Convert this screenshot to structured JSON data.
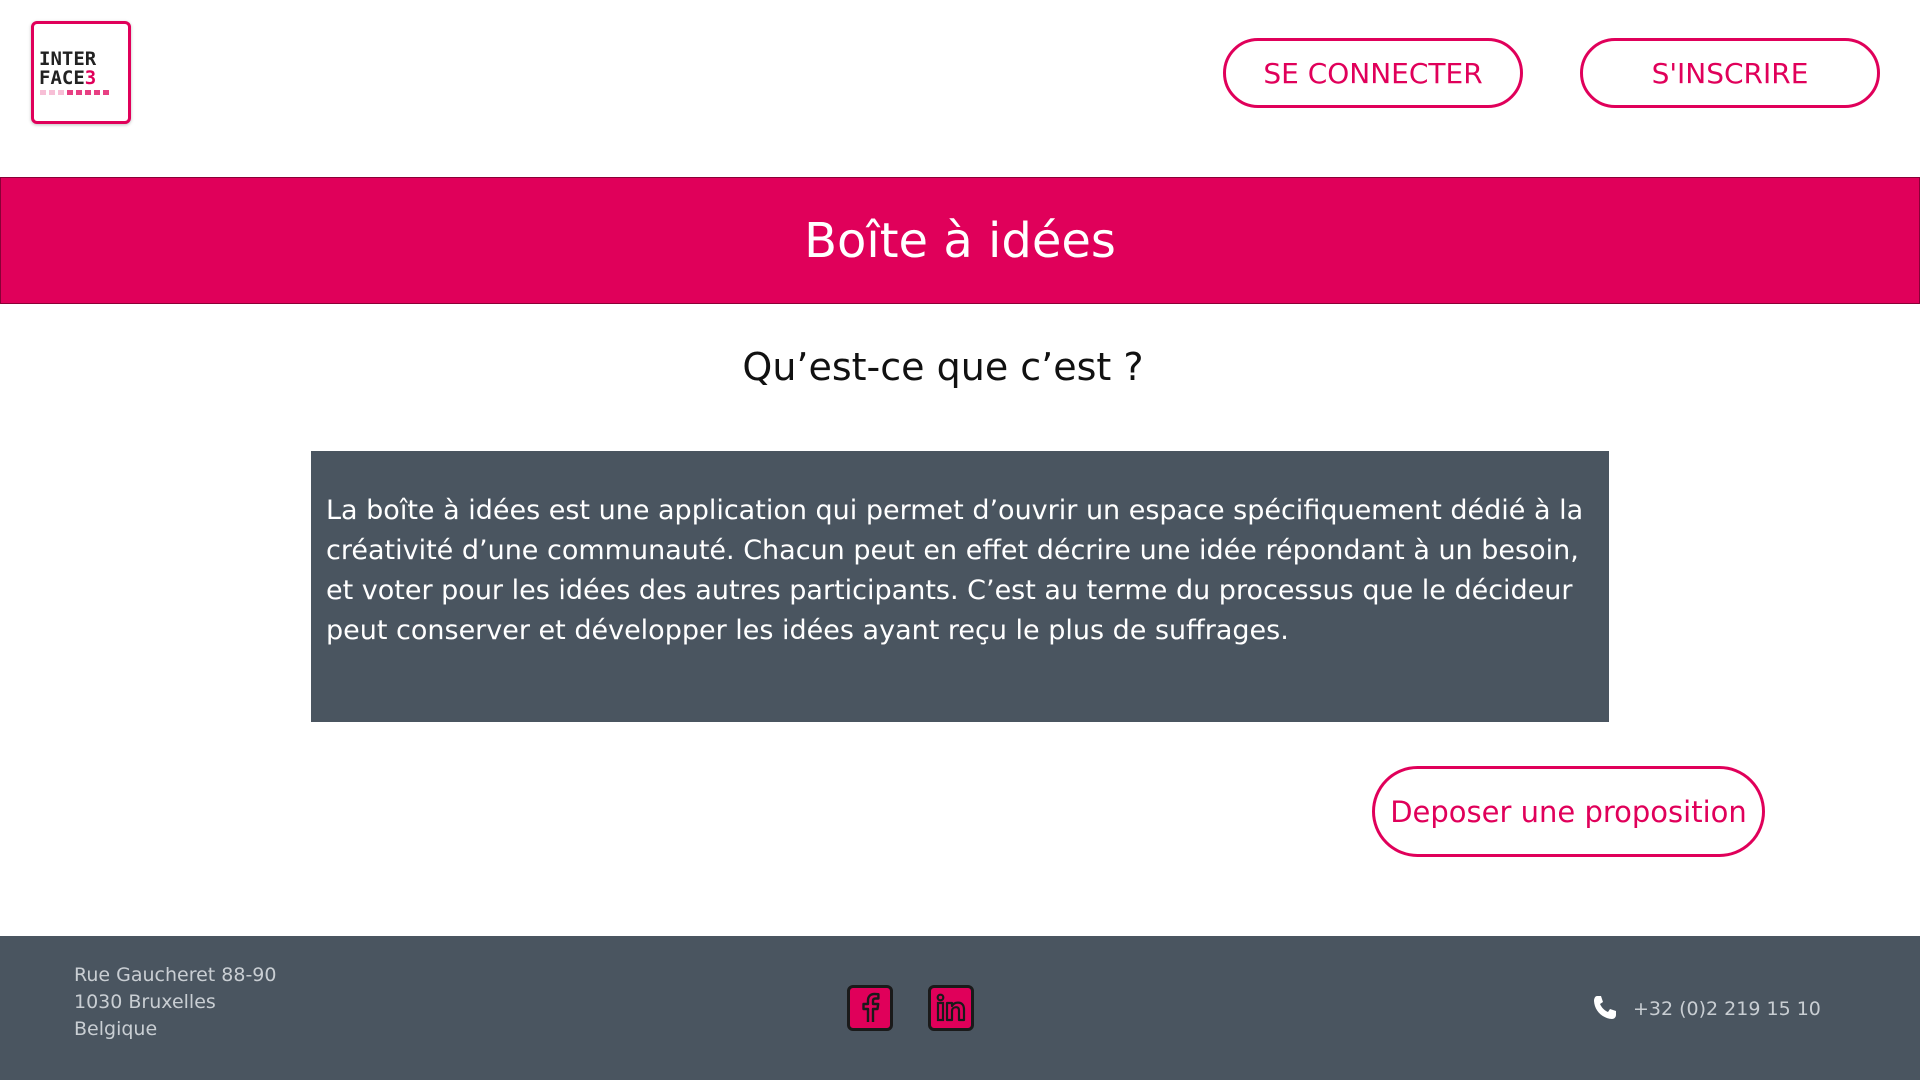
{
  "header": {
    "logo": {
      "line1": "INTER",
      "line2_main": "FACE",
      "line2_accent": "3",
      "icon": "interface3-logo"
    },
    "login_label": "SE CONNECTER",
    "signup_label": "S'INSCRIRE"
  },
  "banner": {
    "title": "Boîte à idées"
  },
  "main": {
    "subtitle": "Qu’est-ce que c’est ?",
    "description": "La boîte à idées est une application qui permet d’ouvrir un espace spécifiquement dédié à la créativité d’une communauté. Chacun peut en effet décrire une idée répondant à un besoin, et voter pour les idées des autres participants. C’est au terme du processus que le décideur peut conserver et développer les idées ayant reçu le plus de suffrages.",
    "propose_label": "Deposer une proposition"
  },
  "footer": {
    "address": [
      "Rue Gaucheret 88-90",
      "1030 Bruxelles",
      "Belgique"
    ],
    "social": [
      {
        "icon": "facebook-icon"
      },
      {
        "icon": "linkedin-icon"
      }
    ],
    "phone_icon": "phone-icon",
    "phone": "+32 (0)2 219 15 10"
  },
  "colors": {
    "accent": "#e0005a",
    "dark": "#4a5560",
    "footer_text": "#c9ced3"
  }
}
